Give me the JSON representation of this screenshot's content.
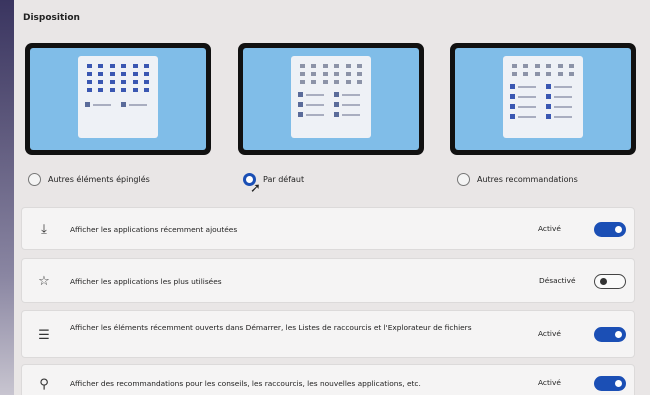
{
  "layout": {
    "title": "Disposition",
    "options": [
      {
        "label": "Autres éléments épinglés",
        "selected": false
      },
      {
        "label": "Par défaut",
        "selected": true
      },
      {
        "label": "Autres recommandations",
        "selected": false
      }
    ]
  },
  "settings": [
    {
      "icon": "download-icon",
      "label": "Afficher les applications récemment ajoutées",
      "status": "Activé",
      "on": true
    },
    {
      "icon": "star-icon",
      "label": "Afficher les applications les plus utilisées",
      "status": "Désactivé",
      "on": false
    },
    {
      "icon": "list-icon",
      "label": "Afficher les éléments récemment ouverts dans Démarrer, les Listes de raccourcis et l'Explorateur de fichiers",
      "status": "Activé",
      "on": true
    },
    {
      "icon": "lightbulb-icon",
      "label": "Afficher des recommandations pour les conseils, les raccourcis, les nouvelles applications, etc.",
      "status": "Activé",
      "on": true
    }
  ],
  "colors": {
    "accent": "#1b4fb5",
    "screen": "#80bde8"
  }
}
